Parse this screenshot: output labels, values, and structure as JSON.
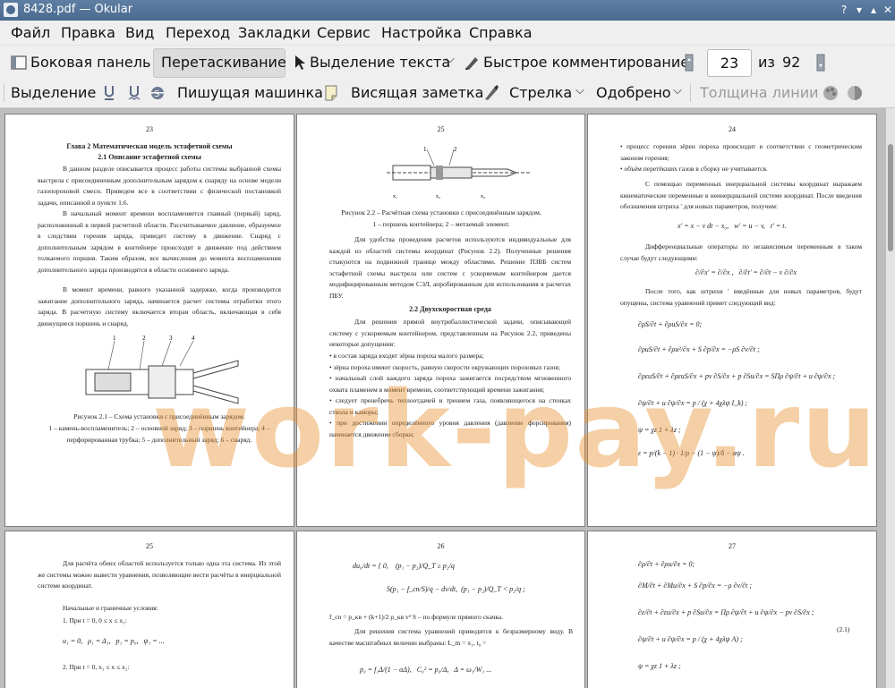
{
  "window": {
    "title": "8428.pdf — Okular"
  },
  "menu": [
    "Файл",
    "Правка",
    "Вид",
    "Переход",
    "Закладки",
    "Сервис",
    "Настройка",
    "Справка"
  ],
  "toolbar1": {
    "sidebar": "Боковая панель",
    "browse": "Перетаскивание",
    "text_select": "Выделение текста",
    "quick_comment": "Быстрое комментирование",
    "page_value": "23",
    "of_label": "из",
    "total_pages": "92"
  },
  "toolbar2": {
    "highlight": "Выделение",
    "typewriter": "Пишущая машинка",
    "popup_note": "Висящая заметка",
    "arrow": "Стрелка",
    "stamp": "Одобрено",
    "line_width": "Толщина линии"
  },
  "watermark": "work-pay.ru",
  "pages": {
    "p23": {
      "number": "23",
      "chapter": "Глава 2 Математическая модель эстафетной схемы",
      "section": "2.1 Описание эстафетной схемы",
      "para1": "В данном разделе описывается процесс работы системы выбранной схемы выстрела с присоединенным дополнительным зарядом к снаряду на основе модели газопороховой смеси. Приведем все в соответствии с физической постановкой задачи, описанной в пункте 1.6.",
      "para2": "В начальный момент времени воспламеняется главный (первый) заряд, расположенный в первой расчетной области. Рассчитываемое давление, образуемое в следствии горения заряда, приведет систему в движение. Снаряд с дополнительным зарядом в контейнере происходят в движение под действием толкаемого поршня. Таким образом, все вычисления до момента воспламенения дополнительного заряда производятся в области основного заряда.",
      "para3": "В момент времени, равного указанной задержке, когда производится зажигание дополнительного заряда, начинается расчет системы отработки этого заряда. В расчетную систему включается вторая область, включающая в себя движущиеся поршень и снаряд.",
      "fig_caption": "Рисунок 2.1 – Схема установки с присоединённым зарядом.",
      "fig_legend": "1 – камень-воспламенитель; 2 – основной заряд; 3 – поршень контейнера; 4 – перфорированная трубка; 5 – дополнительный заряд; 6 – снаряд."
    },
    "p25": {
      "number": "25",
      "fig_caption": "Рисунок 2.2 – Расчётная схема установки с присоединённым зарядом.",
      "fig_legend": "1 – поршень контейнера; 2 – метаемый элемент.",
      "para1": "Для удобства проведения расчетов используются индивидуальные для каждой из областей системы координат (Рисунок 2.2). Полученные решения стыкуются на подвижной границе между областями. Решение ПЗВБ систем эстафетной схемы выстрела или систем с ускоряемым контейнером дается модифицированным методом СЭЛ, апробированным для использования в расчетах ПБУ.",
      "section": "2.2 Двухскоростная среда",
      "para2": "Для решения прямой внутрибаллистической задачи, описывающей систему с ускоряемым контейнером, представленным на Рисунок 2.2, приведены некоторые допущения:",
      "bullets": [
        "в состав заряда входят зёрна пороха малого размера;",
        "зёрна пороха имеют скорость, равную скорости окружающих пороховых газов;",
        "начальный слой каждого заряда пороха зажигается посредством мгновенного охвата пламенем в момент времени, соответствующий времени зажигания;",
        "следует пренебречь теплоотдачей и трением газа, появляющегося на стенках ствола и каморы;",
        "при достижении определённого уровня давления (давление форсирования) начинается движение сборки;"
      ]
    },
    "p24": {
      "number": "24",
      "bullets": [
        "процесс горения зёрен пороха происходит в соответствии с геометрическим законом горения;",
        "объём перетёкших газов в сборку не учитывается."
      ],
      "para1": "С помощью переменных инерциальной системы координат выражаем кинематические переменные в неинерциальной системе координат. После введения обозначения штриха ' для новых параметров, получим:",
      "para2": "Дифференциальные операторы по независимым переменным в таком случае будут следующими:",
      "para3": "После того, как штрихи ' введённые для новых параметров, будут опущены, система уравнений примет следующий вид:"
    },
    "p25b": {
      "number": "25",
      "para1": "Для расчёта обеих областей используется только одна эта система. Из этой же системы можно вывести уравнения, позволяющие вести расчёты в инерциальной системе координат.",
      "para2": "Начальные и граничные условия:",
      "cond1": "1. При t = 0, 0 ≤ x ≤ x₁:",
      "cond2": "2. При t = 0, x₁ ≤ x ≤ x₂:"
    },
    "p26": {
      "number": "26",
      "line1": "f_cn = p_кв + (k+1)/2 ρ_кв v² S – по формуле прямого скачка.",
      "para1": "Для решения система уравнений приводится к безразмерному виду. В качестве масштабных величин выбраны: L_m = x₁, t₀ ="
    },
    "p27": {
      "number": "27",
      "eqnum": "(2.1)"
    }
  }
}
